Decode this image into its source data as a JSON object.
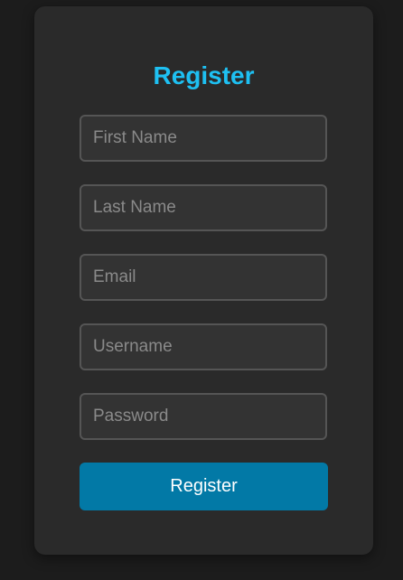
{
  "form": {
    "title": "Register",
    "fields": [
      {
        "placeholder": "First Name",
        "value": ""
      },
      {
        "placeholder": "Last Name",
        "value": ""
      },
      {
        "placeholder": "Email",
        "value": ""
      },
      {
        "placeholder": "Username",
        "value": ""
      },
      {
        "placeholder": "Password",
        "value": ""
      }
    ],
    "submit_label": "Register"
  },
  "colors": {
    "page_background": "#1c1c1c",
    "card_background": "#2a2a2a",
    "title": "#1ec0f2",
    "field_background": "#333333",
    "field_border": "#555555",
    "placeholder": "#8a8a8a",
    "button_background": "#0279a6",
    "button_text": "#ffffff"
  }
}
